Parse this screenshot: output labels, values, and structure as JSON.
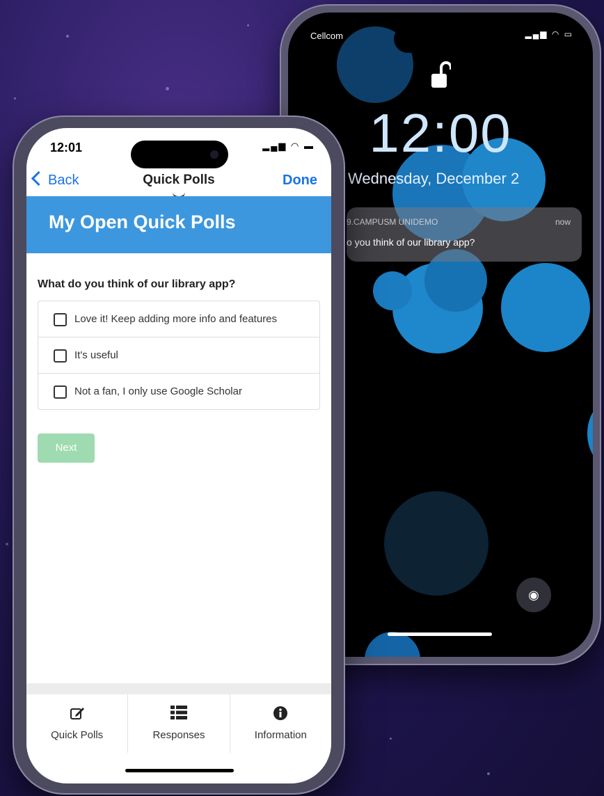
{
  "lock_screen": {
    "carrier": "Cellcom",
    "time": "12:00",
    "date": "Wednesday, December 2",
    "notification": {
      "app": "9.CAMPUSM UNIDEMO",
      "when": "now",
      "message": "o you think of our library app?"
    }
  },
  "app": {
    "status_time": "12:01",
    "nav": {
      "back_label": "Back",
      "title": "Quick Polls",
      "done_label": "Done"
    },
    "banner_title": "My Open Quick Polls",
    "poll": {
      "question": "What do you think of our library app?",
      "options": [
        "Love it! Keep adding more info and features",
        "It's useful",
        "Not a fan, I only use Google Scholar"
      ],
      "next_label": "Next"
    },
    "tabs": [
      {
        "label": "Quick Polls",
        "icon": "edit-icon"
      },
      {
        "label": "Responses",
        "icon": "list-icon"
      },
      {
        "label": "Information",
        "icon": "info-icon"
      }
    ]
  },
  "colors": {
    "accent_blue": "#3d97de",
    "link_blue": "#1a73e8",
    "next_button": "#9fdbb0"
  }
}
